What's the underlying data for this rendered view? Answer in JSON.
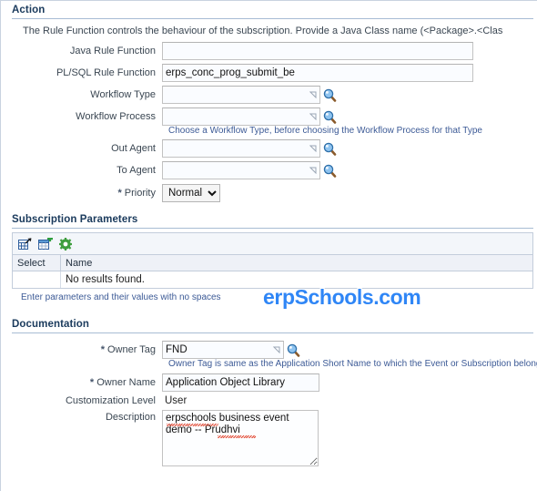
{
  "action_section": {
    "title": "Action",
    "intro": "The Rule Function controls the behaviour of the subscription. Provide a Java Class name (<Package>.<Clas",
    "fields": {
      "java_rule_function": {
        "label": "Java Rule Function",
        "value": ""
      },
      "plsql_rule_function": {
        "label": "PL/SQL Rule Function",
        "value": "erps_conc_prog_submit_be"
      },
      "workflow_type": {
        "label": "Workflow Type",
        "value": ""
      },
      "workflow_process": {
        "label": "Workflow Process",
        "value": "",
        "hint": "Choose a Workflow Type, before choosing the Workflow Process for that Type"
      },
      "out_agent": {
        "label": "Out Agent",
        "value": ""
      },
      "to_agent": {
        "label": "To Agent",
        "value": ""
      },
      "priority": {
        "label": "Priority",
        "required": "*",
        "value": "Normal",
        "options": [
          "Normal"
        ]
      }
    }
  },
  "subscription_parameters": {
    "title": "Subscription Parameters",
    "toolbar": [
      {
        "name": "export-icon"
      },
      {
        "name": "add-row-icon"
      },
      {
        "name": "settings-gear-icon"
      }
    ],
    "columns": [
      "Select",
      "Name"
    ],
    "rows": [
      {
        "select": "",
        "name": "No results found."
      }
    ],
    "hint": "Enter parameters and their values with no spaces"
  },
  "documentation": {
    "title": "Documentation",
    "fields": {
      "owner_tag": {
        "label": "Owner Tag",
        "required": "*",
        "value": "FND",
        "hint": "Owner Tag is same as the Application Short Name to which the Event or Subscription belongs"
      },
      "owner_name": {
        "label": "Owner Name",
        "required": "*",
        "value": "Application Object Library"
      },
      "customization_level": {
        "label": "Customization Level",
        "value": "User"
      },
      "description": {
        "label": "Description",
        "value": "erpschools business event demo -- Prudhvi"
      }
    }
  },
  "watermark": {
    "text": "erpSchools.com"
  },
  "colors": {
    "section_header": "#1a3a5c",
    "hint_text": "#3c5a96",
    "watermark": "#2f86f6",
    "grid_border": "#c3cddb"
  }
}
